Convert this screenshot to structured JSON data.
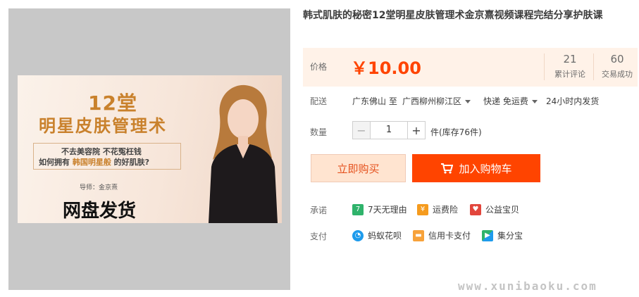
{
  "banner": {
    "num": "12堂",
    "title": "明星皮肤管理术",
    "line1": "不去美容院  不花冤枉钱",
    "line2_pre": "如何拥有 ",
    "line2_hl": "韩国明星般",
    "line2_post": " 的好肌肤?",
    "mentor": "导师：金京熹",
    "big": "网盘发货"
  },
  "product": {
    "title": "韩式肌肤的秘密12堂明星皮肤管理术金京熹视频课程完结分享护肤课"
  },
  "price": {
    "label": "价格",
    "value": "￥10.00",
    "reviews_count": "21",
    "reviews_label": "累计评论",
    "sales_count": "60",
    "sales_label": "交易成功"
  },
  "shipping": {
    "label": "配送",
    "from": "广东佛山 至",
    "to": "广西柳州柳江区",
    "method": "快递 免运费",
    "time": "24小时内发货"
  },
  "quantity": {
    "label": "数量",
    "value": "1",
    "minus": "−",
    "plus": "+",
    "stock": "件(库存76件)"
  },
  "actions": {
    "buy": "立即购买",
    "cart": "加入购物车"
  },
  "promise": {
    "label": "承诺",
    "items": [
      "7天无理由",
      "运费险",
      "公益宝贝"
    ]
  },
  "payment": {
    "label": "支付",
    "items": [
      "蚂蚁花呗",
      "信用卡支付",
      "集分宝"
    ]
  },
  "watermark": "www.xunibaoku.com",
  "colors": {
    "accent": "#ff4400",
    "price_bg": "#fff2e8",
    "buy_bg": "#ffe4d0"
  }
}
